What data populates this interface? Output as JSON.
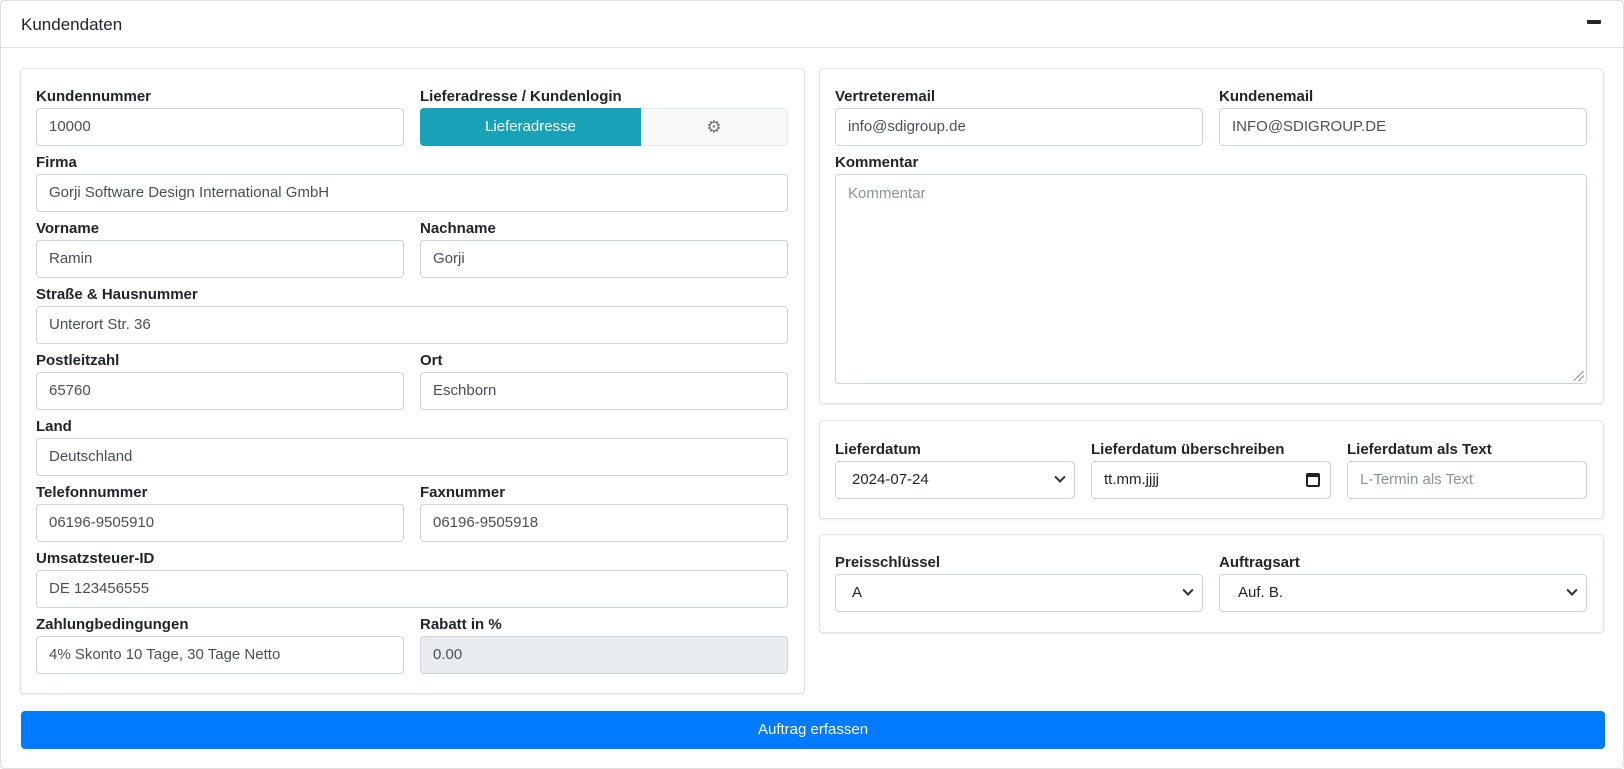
{
  "header": {
    "title": "Kundendaten"
  },
  "customer": {
    "kundennummer": {
      "label": "Kundennummer",
      "value": "10000"
    },
    "lieferadresse": {
      "label": "Lieferadresse / Kundenlogin",
      "button_label": "Lieferadresse"
    },
    "firma": {
      "label": "Firma",
      "value": "Gorji Software Design International GmbH"
    },
    "vorname": {
      "label": "Vorname",
      "value": "Ramin"
    },
    "nachname": {
      "label": "Nachname",
      "value": "Gorji"
    },
    "strasse": {
      "label": "Straße & Hausnummer",
      "value": "Unterort Str. 36"
    },
    "plz": {
      "label": "Postleitzahl",
      "value": "65760"
    },
    "ort": {
      "label": "Ort",
      "value": "Eschborn"
    },
    "land": {
      "label": "Land",
      "value": "Deutschland"
    },
    "telefon": {
      "label": "Telefonnummer",
      "value": "06196-9505910"
    },
    "fax": {
      "label": "Faxnummer",
      "value": "06196-9505918"
    },
    "ustid": {
      "label": "Umsatzsteuer-ID",
      "value": "DE 123456555"
    },
    "zahlung": {
      "label": "Zahlungbedingungen",
      "value": "4% Skonto 10 Tage, 30 Tage Netto"
    },
    "rabatt": {
      "label": "Rabatt in %",
      "value": "0.00"
    }
  },
  "contact": {
    "vertreteremail": {
      "label": "Vertreteremail",
      "value": "info@sdigroup.de"
    },
    "kundenemail": {
      "label": "Kundenemail",
      "value": "INFO@SDIGROUP.DE"
    },
    "kommentar": {
      "label": "Kommentar",
      "placeholder": "Kommentar"
    }
  },
  "delivery": {
    "lieferdatum": {
      "label": "Lieferdatum",
      "value": "2024-07-24"
    },
    "ueberschreiben": {
      "label": "Lieferdatum überschreiben",
      "value": "tt.mm.jjjj"
    },
    "als_text": {
      "label": "Lieferdatum als Text",
      "placeholder": "L-Termin als Text"
    }
  },
  "order": {
    "preisschluessel": {
      "label": "Preisschlüssel",
      "value": "A"
    },
    "auftragsart": {
      "label": "Auftragsart",
      "value": "Auf. B."
    }
  },
  "submit": {
    "label": "Auftrag erfassen"
  },
  "icons": {
    "settings": "gear-icon",
    "collapse": "minus-icon",
    "calendar": "calendar-icon",
    "dropdown": "chevron-down-icon"
  },
  "colors": {
    "teal": "#17a2b8",
    "primary": "#007bff"
  }
}
